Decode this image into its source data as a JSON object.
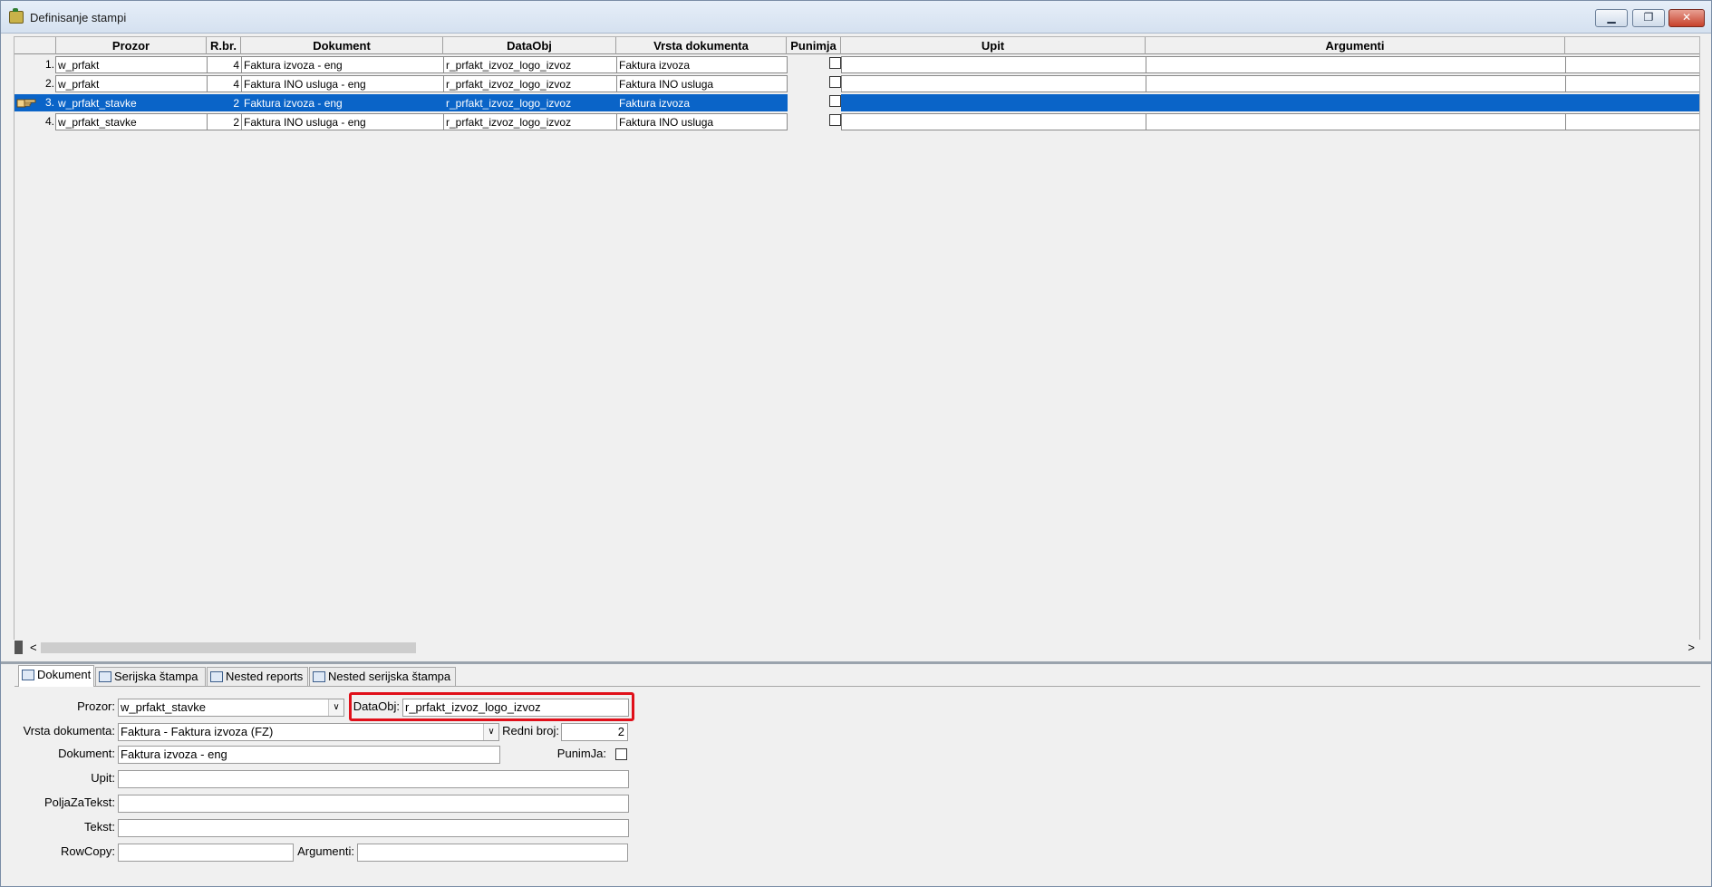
{
  "window": {
    "title": "Definisanje stampi",
    "minimize_label": "▁",
    "restore_label": "❐",
    "close_label": "✕"
  },
  "grid": {
    "columns": [
      "Prozor",
      "R.br.",
      "Dokument",
      "DataObj",
      "Vrsta dokumenta",
      "Punimja",
      "Upit",
      "Argumenti"
    ],
    "rows": [
      {
        "rownum": "1.",
        "prozor": "w_prfakt",
        "rbr": "4",
        "dokument": "Faktura izvoza - eng",
        "dataobj": "r_prfakt_izvoz_logo_izvoz",
        "vrsta": "Faktura izvoza",
        "punimja": false,
        "upit": "",
        "argumenti": ""
      },
      {
        "rownum": "2.",
        "prozor": "w_prfakt",
        "rbr": "4",
        "dokument": "Faktura INO usluga - eng",
        "dataobj": "r_prfakt_izvoz_logo_izvoz",
        "vrsta": "Faktura INO usluga",
        "punimja": false,
        "upit": "",
        "argumenti": ""
      },
      {
        "rownum": "3.",
        "prozor": "w_prfakt_stavke",
        "rbr": "2",
        "dokument": "Faktura izvoza - eng",
        "dataobj": "r_prfakt_izvoz_logo_izvoz",
        "vrsta": "Faktura izvoza",
        "punimja": false,
        "upit": "",
        "argumenti": "",
        "selected": true
      },
      {
        "rownum": "4.",
        "prozor": "w_prfakt_stavke",
        "rbr": "2",
        "dokument": "Faktura INO usluga - eng",
        "dataobj": "r_prfakt_izvoz_logo_izvoz",
        "vrsta": "Faktura INO usluga",
        "punimja": false,
        "upit": "",
        "argumenti": ""
      }
    ]
  },
  "scroll": {
    "left": "<",
    "right": ">"
  },
  "tabs": [
    "Dokument",
    "Serijska štampa",
    "Nested reports",
    "Nested serijska štampa"
  ],
  "form": {
    "prozor_label": "Prozor:",
    "prozor_value": "w_prfakt_stavke",
    "dataobj_label": "DataObj:",
    "dataobj_value": "r_prfakt_izvoz_logo_izvoz",
    "vrsta_label": "Vrsta dokumenta:",
    "vrsta_value": "Faktura  -  Faktura izvoza (FZ)",
    "redni_label": "Redni broj:",
    "redni_value": "2",
    "dokument_label": "Dokument:",
    "dokument_value": "Faktura izvoza - eng",
    "punimja_label": "PunimJa:",
    "upit_label": "Upit:",
    "upit_value": "",
    "polja_label": "PoljaZaTekst:",
    "polja_value": "",
    "tekst_label": "Tekst:",
    "tekst_value": "",
    "rowcopy_label": "RowCopy:",
    "rowcopy_value": "",
    "argumenti_label": "Argumenti:",
    "argumenti_value": ""
  },
  "colors": {
    "selection": "#0a64c8",
    "highlight_border": "#e0101a"
  }
}
